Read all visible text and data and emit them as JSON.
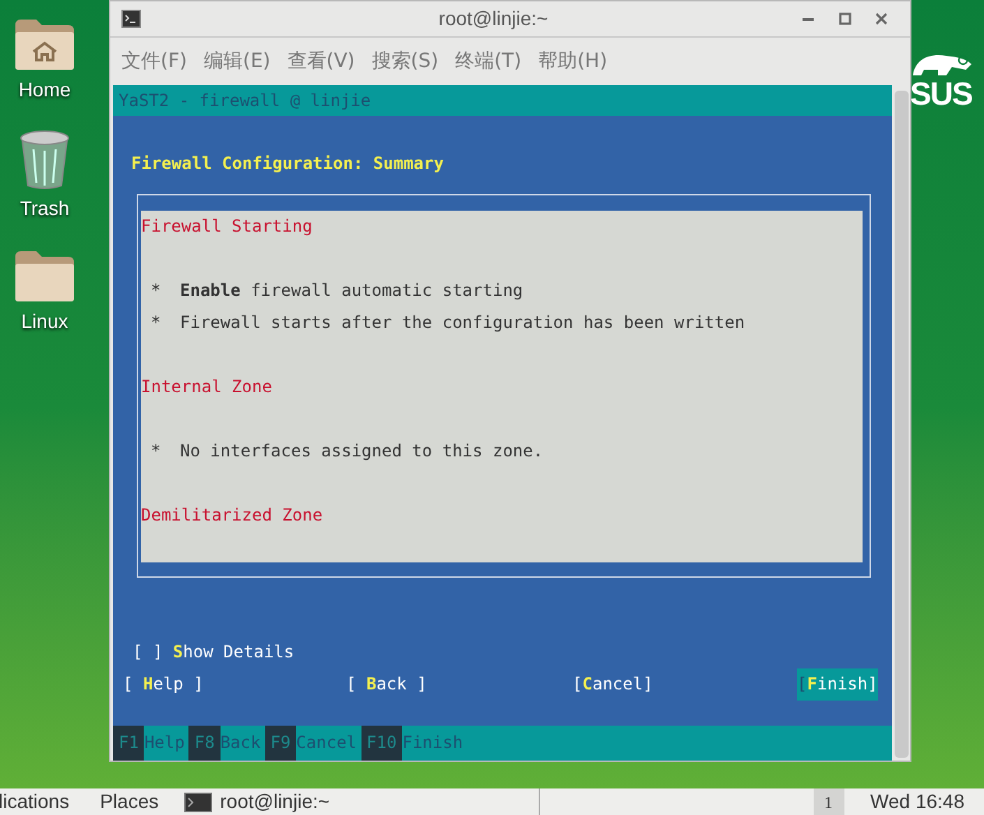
{
  "desktop_icons": [
    {
      "label": "Home",
      "kind": "home"
    },
    {
      "label": "Trash",
      "kind": "trash"
    },
    {
      "label": "Linux",
      "kind": "folder"
    }
  ],
  "logo": {
    "text": "SUS"
  },
  "window": {
    "title": "root@linjie:~",
    "menu": [
      "文件(F)",
      "编辑(E)",
      "查看(V)",
      "搜索(S)",
      "终端(T)",
      "帮助(H)"
    ]
  },
  "terminal": {
    "title": "YaST2 - firewall @ linjie",
    "heading": "Firewall Configuration: Summary",
    "sections": [
      {
        "heading": "Firewall Starting",
        "bullets": [
          {
            "mark": "*",
            "text": "**Enable** firewall automatic starting"
          },
          {
            "mark": "*",
            "text": "Firewall starts after the configuration has been written"
          }
        ]
      },
      {
        "heading": "Internal Zone",
        "bullets": [
          {
            "mark": "*",
            "text": "No interfaces assigned to this zone."
          }
        ]
      },
      {
        "heading": "Demilitarized Zone"
      }
    ],
    "checkbox": {
      "box": "[ ]",
      "key": "S",
      "rest": "how Details",
      "checked": false
    },
    "buttons": [
      {
        "lead": "[ ",
        "key": "H",
        "rest": "elp ]",
        "selected": false
      },
      {
        "lead": "[ ",
        "key": "B",
        "rest": "ack ]",
        "selected": false
      },
      {
        "lead": "[",
        "key": "C",
        "rest": "ancel]",
        "selected": false
      },
      {
        "lead": "[",
        "key": "F",
        "rest": "inish]",
        "selected": true
      }
    ],
    "function_keys": [
      {
        "key": "F1",
        "label": "Help"
      },
      {
        "key": "F8",
        "label": "Back"
      },
      {
        "key": "F9",
        "label": "Cancel"
      },
      {
        "key": "F10",
        "label": "Finish"
      }
    ]
  },
  "taskbar": {
    "items": [
      "lications",
      "Places"
    ],
    "task": "root@linjie:~",
    "workspace": "1",
    "clock": "Wed 16:48"
  }
}
